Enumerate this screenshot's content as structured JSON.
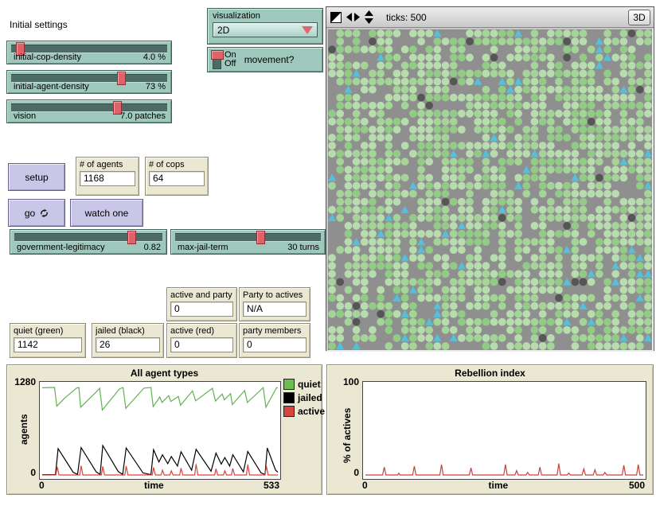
{
  "world_header": {
    "ticks": "ticks: 500",
    "view_3d": "3D"
  },
  "controls": {
    "heading": "Initial settings",
    "sliders": [
      {
        "label": "initial-cop-density",
        "value": "4.0 %",
        "pos": 0.04
      },
      {
        "label": "initial-agent-density",
        "value": "73 %",
        "pos": 0.73
      },
      {
        "label": "vision",
        "value": "7.0 patches",
        "pos": 0.7
      },
      {
        "label": "government-legitimacy",
        "value": "0.82",
        "pos": 0.82
      },
      {
        "label": "max-jail-term",
        "value": "30 turns",
        "pos": 0.6
      }
    ],
    "chooser": {
      "label": "visualization",
      "value": "2D"
    },
    "switch": {
      "on_label": "On",
      "off_label": "Off",
      "label": "movement?",
      "state": "on"
    },
    "buttons": {
      "setup": "setup",
      "go": "go",
      "watch_one": "watch one"
    }
  },
  "monitors": [
    {
      "label": "# of agents",
      "value": "1168"
    },
    {
      "label": "# of cops",
      "value": "64"
    },
    {
      "label": "active and party",
      "value": "0"
    },
    {
      "label": "Party to actives",
      "value": "N/A"
    },
    {
      "label": "quiet (green)",
      "value": "1142"
    },
    {
      "label": "jailed (black)",
      "value": "26"
    },
    {
      "label": "active (red)",
      "value": "0"
    },
    {
      "label": "party members",
      "value": "0"
    }
  ],
  "world": {
    "grid": 40,
    "seed": 20,
    "background": "#8f8f8f",
    "agent_density": 0.73,
    "agent_colors": [
      "#b7dcad",
      "#a4d498",
      "#92cb86"
    ],
    "cop_count": 64,
    "cop_color": "#55c0da",
    "jailed_count": 26,
    "jailed_color": "#565656"
  },
  "chart_data": [
    {
      "type": "line",
      "title": "All agent types",
      "xlabel": "time",
      "ylabel": "agents",
      "xlim": [
        0,
        533
      ],
      "ylim": [
        0,
        1280
      ],
      "x_min_label": "0",
      "x_max_label": "533",
      "y_min_label": "0",
      "y_max_label": "1280",
      "legend_position": "right",
      "legend": [
        {
          "label": "quiet",
          "color": "#6cbf4e"
        },
        {
          "label": "jailed",
          "color": "#000000"
        },
        {
          "label": "active",
          "color": "#d8443e"
        }
      ],
      "series": [
        {
          "name": "quiet",
          "color": "#5fb350",
          "points": [
            [
              0,
              1275
            ],
            [
              28,
              1280
            ],
            [
              33,
              1005
            ],
            [
              50,
              1120
            ],
            [
              78,
              1272
            ],
            [
              83,
              1280
            ],
            [
              87,
              990
            ],
            [
              120,
              1200
            ],
            [
              130,
              1268
            ],
            [
              136,
              950
            ],
            [
              175,
              1260
            ],
            [
              183,
              1278
            ],
            [
              189,
              975
            ],
            [
              230,
              1270
            ],
            [
              246,
              1280
            ],
            [
              251,
              1000
            ],
            [
              266,
              1140
            ],
            [
              271,
              1060
            ],
            [
              286,
              1160
            ],
            [
              291,
              1075
            ],
            [
              308,
              1150
            ],
            [
              313,
              1020
            ],
            [
              340,
              1230
            ],
            [
              347,
              1085
            ],
            [
              385,
              1268
            ],
            [
              392,
              1080
            ],
            [
              407,
              1185
            ],
            [
              412,
              1100
            ],
            [
              426,
              1190
            ],
            [
              430,
              1030
            ],
            [
              458,
              1235
            ],
            [
              464,
              1060
            ],
            [
              500,
              1278
            ],
            [
              506,
              990
            ],
            [
              530,
              1275
            ],
            [
              533,
              1278
            ]
          ]
        },
        {
          "name": "jailed",
          "color": "#000000",
          "points": [
            [
              0,
              5
            ],
            [
              30,
              5
            ],
            [
              36,
              385
            ],
            [
              70,
              40
            ],
            [
              80,
              8
            ],
            [
              88,
              400
            ],
            [
              122,
              45
            ],
            [
              131,
              8
            ],
            [
              137,
              430
            ],
            [
              172,
              50
            ],
            [
              182,
              8
            ],
            [
              190,
              395
            ],
            [
              228,
              30
            ],
            [
              246,
              5
            ],
            [
              252,
              370
            ],
            [
              264,
              190
            ],
            [
              272,
              295
            ],
            [
              284,
              165
            ],
            [
              292,
              270
            ],
            [
              306,
              130
            ],
            [
              314,
              340
            ],
            [
              338,
              70
            ],
            [
              348,
              375
            ],
            [
              382,
              55
            ],
            [
              393,
              320
            ],
            [
              405,
              160
            ],
            [
              413,
              255
            ],
            [
              424,
              130
            ],
            [
              431,
              295
            ],
            [
              455,
              45
            ],
            [
              465,
              345
            ],
            [
              495,
              30
            ],
            [
              504,
              8
            ],
            [
              509,
              395
            ],
            [
              528,
              70
            ],
            [
              533,
              40
            ]
          ]
        },
        {
          "name": "active",
          "color": "#d8443e",
          "points": [
            [
              0,
              0
            ],
            [
              31,
              0
            ],
            [
              34,
              120
            ],
            [
              38,
              0
            ],
            [
              85,
              0
            ],
            [
              88,
              135
            ],
            [
              92,
              0
            ],
            [
              134,
              0
            ],
            [
              137,
              125
            ],
            [
              141,
              0
            ],
            [
              187,
              0
            ],
            [
              190,
              130
            ],
            [
              194,
              0
            ],
            [
              249,
              0
            ],
            [
              252,
              110
            ],
            [
              256,
              0
            ],
            [
              269,
              0
            ],
            [
              272,
              70
            ],
            [
              276,
              0
            ],
            [
              289,
              0
            ],
            [
              292,
              60
            ],
            [
              296,
              0
            ],
            [
              311,
              0
            ],
            [
              314,
              100
            ],
            [
              318,
              0
            ],
            [
              345,
              0
            ],
            [
              348,
              160
            ],
            [
              352,
              0
            ],
            [
              390,
              0
            ],
            [
              393,
              90
            ],
            [
              397,
              0
            ],
            [
              410,
              0
            ],
            [
              413,
              60
            ],
            [
              417,
              0
            ],
            [
              428,
              0
            ],
            [
              431,
              95
            ],
            [
              435,
              0
            ],
            [
              462,
              0
            ],
            [
              465,
              155
            ],
            [
              469,
              0
            ],
            [
              504,
              0
            ],
            [
              507,
              130
            ],
            [
              511,
              0
            ],
            [
              533,
              0
            ]
          ]
        }
      ]
    },
    {
      "type": "line",
      "title": "Rebellion index",
      "xlabel": "time",
      "ylabel": "% of actives",
      "xlim": [
        0,
        500
      ],
      "ylim": [
        0,
        100
      ],
      "x_min_label": "0",
      "x_max_label": "500",
      "y_min_label": "0",
      "y_max_label": "100",
      "series": [
        {
          "name": "% of actives",
          "color": "#c8423c",
          "points": [
            [
              0,
              0
            ],
            [
              31,
              0
            ],
            [
              34,
              9
            ],
            [
              37,
              0
            ],
            [
              58,
              0
            ],
            [
              60,
              2
            ],
            [
              62,
              0
            ],
            [
              85,
              0
            ],
            [
              88,
              10
            ],
            [
              91,
              0
            ],
            [
              134,
              0
            ],
            [
              137,
              12
            ],
            [
              140,
              0
            ],
            [
              187,
              0
            ],
            [
              190,
              8
            ],
            [
              193,
              0
            ],
            [
              249,
              0
            ],
            [
              252,
              12
            ],
            [
              255,
              0
            ],
            [
              269,
              0
            ],
            [
              272,
              5
            ],
            [
              275,
              0
            ],
            [
              289,
              0
            ],
            [
              292,
              3
            ],
            [
              295,
              0
            ],
            [
              311,
              0
            ],
            [
              314,
              9
            ],
            [
              317,
              0
            ],
            [
              345,
              0
            ],
            [
              348,
              13
            ],
            [
              351,
              0
            ],
            [
              363,
              0
            ],
            [
              366,
              2
            ],
            [
              369,
              0
            ],
            [
              390,
              0
            ],
            [
              393,
              7
            ],
            [
              396,
              0
            ],
            [
              410,
              0
            ],
            [
              413,
              6
            ],
            [
              416,
              0
            ],
            [
              428,
              0
            ],
            [
              431,
              3
            ],
            [
              434,
              0
            ],
            [
              462,
              0
            ],
            [
              465,
              11
            ],
            [
              468,
              0
            ],
            [
              488,
              0
            ],
            [
              491,
              12
            ],
            [
              494,
              0
            ],
            [
              500,
              0
            ]
          ]
        }
      ]
    }
  ]
}
